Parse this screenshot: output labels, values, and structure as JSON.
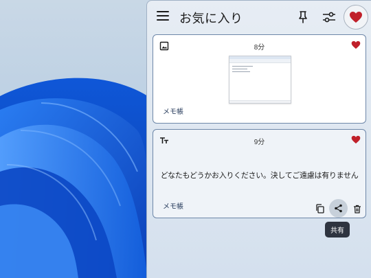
{
  "panel": {
    "title": "お気に入り"
  },
  "header_icons": {
    "menu": "hamburger-menu-icon",
    "pin": "pin-icon",
    "filter": "filter-settings-icon",
    "favorites": "heart-icon"
  },
  "items": [
    {
      "type_icon": "image-icon",
      "time": "8分",
      "source": "メモ帳",
      "favorited": true
    },
    {
      "type_icon": "text-icon",
      "time": "9分",
      "text": "どなたもどうかお入りください。決してご遠慮は有りません",
      "source": "メモ帳",
      "favorited": true
    }
  ],
  "tooltip": "共有",
  "colors": {
    "heart": "#c0202a",
    "card_border": "#6c86a8",
    "tooltip_bg": "#2e3440",
    "wallpaper_blue": "#0a5fe6"
  }
}
